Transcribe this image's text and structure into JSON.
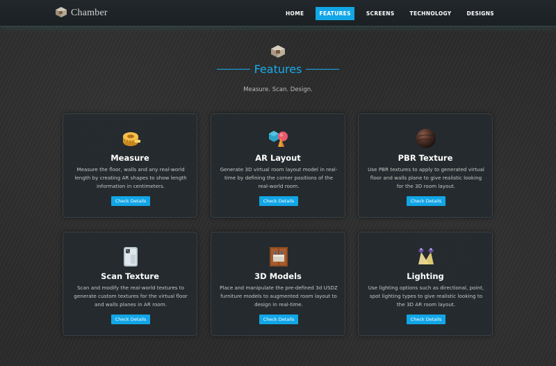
{
  "navbar": {
    "brand": "Chamber",
    "items": [
      {
        "label": "HOME",
        "active": false
      },
      {
        "label": "FEATURES",
        "active": true
      },
      {
        "label": "SCREENS",
        "active": false
      },
      {
        "label": "TECHNOLOGY",
        "active": false
      },
      {
        "label": "DESIGNS",
        "active": false
      }
    ]
  },
  "section": {
    "title": "Features",
    "subtitle": "Measure. Scan. Design.",
    "accent_color": "#17aef0"
  },
  "features": [
    {
      "icon": "measuring-tape-icon",
      "title": "Measure",
      "description": "Measure the floor, walls and any real-world length by creating AR shapes to show length information in centimeters.",
      "button": "Check Details"
    },
    {
      "icon": "shapes-icon",
      "title": "AR Layout",
      "description": "Generate 3D virtual room layout model in real-time by defining the corner positions of the real-world room.",
      "button": "Check Details"
    },
    {
      "icon": "sphere-texture-icon",
      "title": "PBR Texture",
      "description": "Use PBR textures to apply to generated virtual floor and walls plane to give realistic looking for the 3D room layout.",
      "button": "Check Details"
    },
    {
      "icon": "phone-icon",
      "title": "Scan Texture",
      "description": "Scan and modify the real-world textures to generate custom textures for the virtual floor and walls planes in AR room.",
      "button": "Check Details"
    },
    {
      "icon": "furniture-icon",
      "title": "3D Models",
      "description": "Place and manipulate the pre-defined 3d USDZ furniture models to augmented room layout to design in real-time.",
      "button": "Check Details"
    },
    {
      "icon": "spotlight-icon",
      "title": "Lighting",
      "description": "Use lighting options such as directional, point, spot lighting types to give realistic looking to the 3D AR room layout.",
      "button": "Check Details"
    }
  ]
}
